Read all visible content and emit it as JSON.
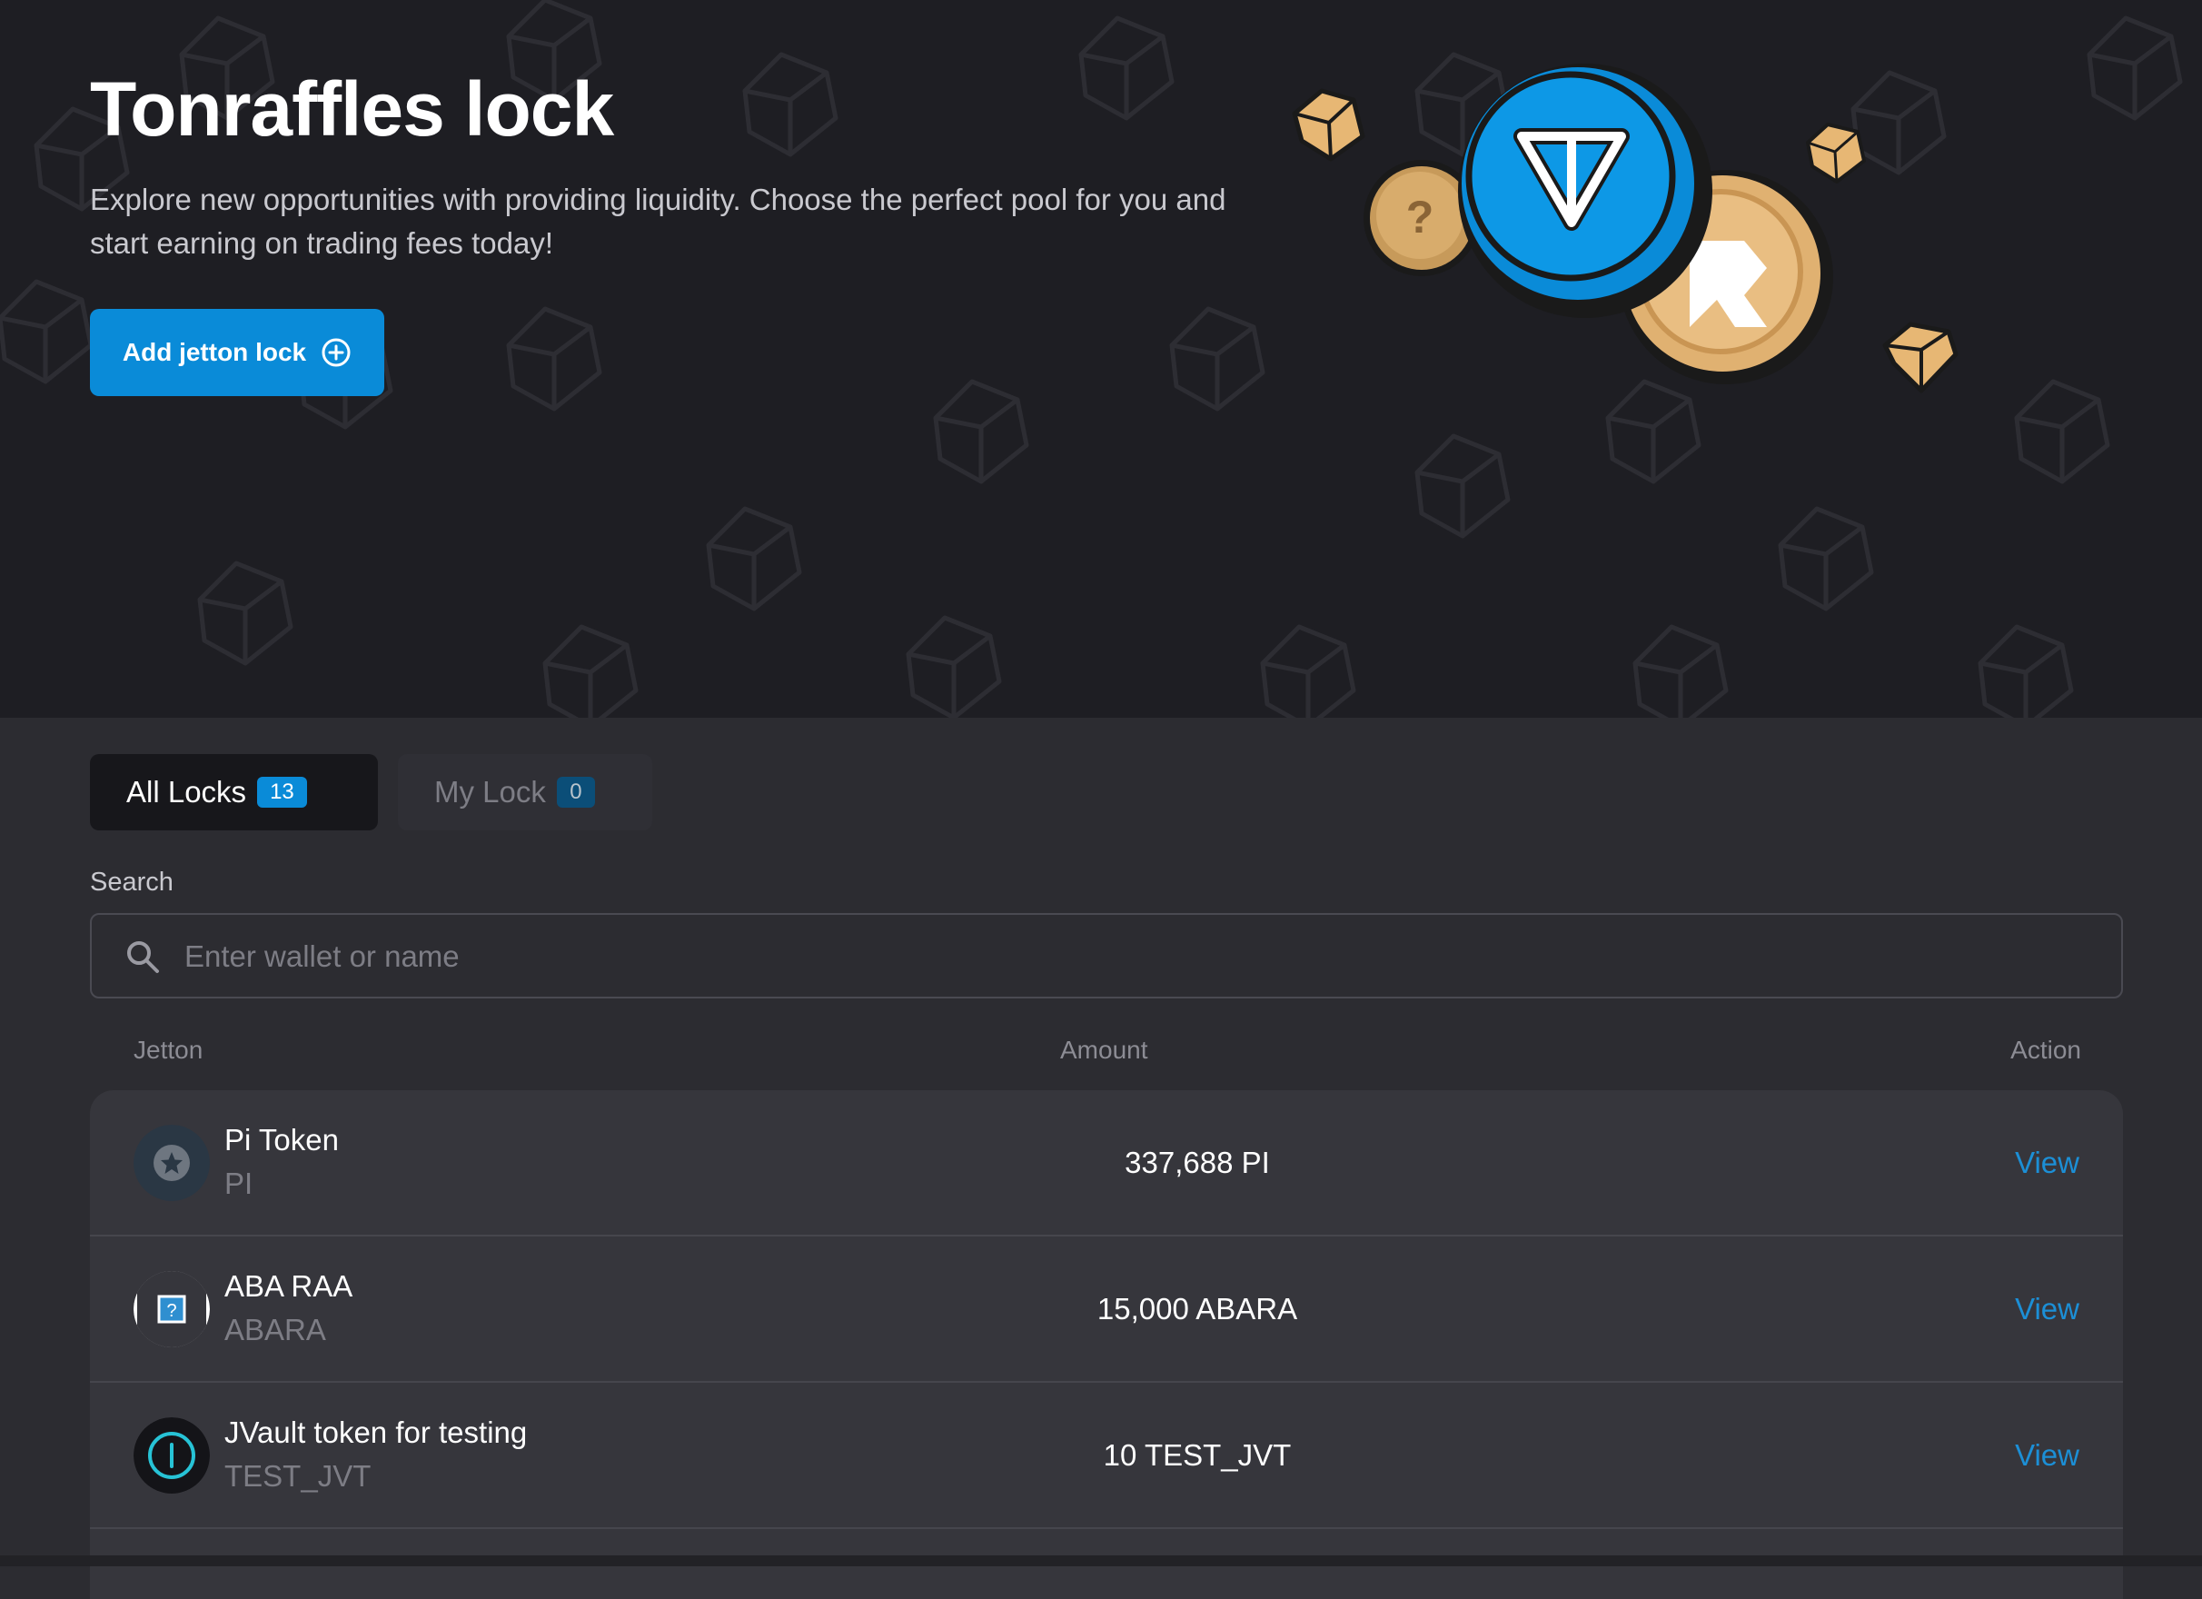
{
  "hero": {
    "title": "Tonraffles lock",
    "description": "Explore new opportunities with providing liquidity. Choose the perfect pool for you and start earning on trading fees today!",
    "add_button_label": "Add jetton lock"
  },
  "tabs": [
    {
      "label": "All Locks",
      "count": "13",
      "active": true
    },
    {
      "label": "My Lock",
      "count": "0",
      "active": false
    }
  ],
  "search": {
    "label": "Search",
    "placeholder": "Enter wallet or name"
  },
  "table": {
    "headers": {
      "jetton": "Jetton",
      "amount": "Amount",
      "action": "Action"
    },
    "rows": [
      {
        "name": "Pi Token",
        "symbol": "PI",
        "amount": "337,688 PI",
        "action": "View",
        "icon": "star-coin-icon"
      },
      {
        "name": "ABA RAA",
        "symbol": "ABARA",
        "amount": "15,000 ABARA",
        "action": "View",
        "icon": "question-box-icon"
      },
      {
        "name": "JVault token for testing",
        "symbol": "TEST_JVT",
        "amount": "10 TEST_JVT",
        "action": "View",
        "icon": "power-ring-icon"
      }
    ]
  },
  "colors": {
    "accent": "#0a8bd8",
    "hero_background": "#1e1e23",
    "page_background": "#2c2c31",
    "row_background": "#36363c",
    "link": "#1c8fd6"
  }
}
